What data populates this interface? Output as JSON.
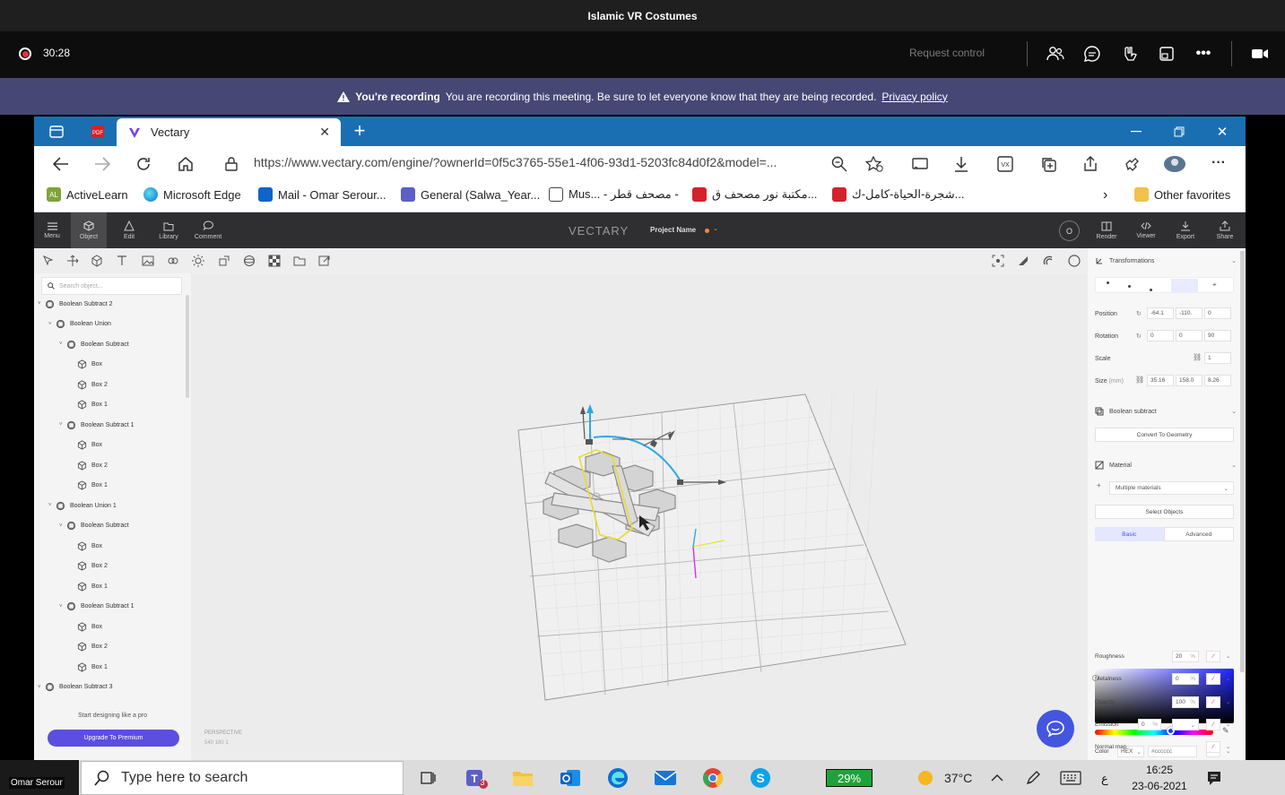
{
  "teams": {
    "meeting_title": "Islamic VR Costumes",
    "timer": "30:28",
    "request_control": "Request control",
    "banner": {
      "bold": "You're recording",
      "text": "You are recording this meeting. Be sure to let everyone know that they are being recorded.",
      "link": "Privacy policy"
    }
  },
  "browser": {
    "tab_title": "Vectary",
    "url": "https://www.vectary.com/engine/?ownerId=0f5c3765-55e1-4f06-93d1-5203fc84d0f2&model=...",
    "favorites": [
      {
        "label": "ActiveLearn"
      },
      {
        "label": "Microsoft Edge"
      },
      {
        "label": "Mail - Omar Serour..."
      },
      {
        "label": "General (Salwa_Year..."
      },
      {
        "label": "Mus... - مصحف قطر -"
      },
      {
        "label": "مكتبة نور مصحف ق..."
      },
      {
        "label": "شجرة-الحياة-كامل-ك..."
      }
    ],
    "other_favorites": "Other favorites"
  },
  "vectary": {
    "logo": "VECTARY",
    "project_name": "Project Name",
    "avatar_letter": "O",
    "left_buttons": [
      {
        "label": "Menu"
      },
      {
        "label": "Object"
      },
      {
        "label": "Edit"
      },
      {
        "label": "Library"
      },
      {
        "label": "Comment"
      }
    ],
    "right_buttons": [
      {
        "label": "Render"
      },
      {
        "label": "Viewer"
      },
      {
        "label": "Export"
      },
      {
        "label": "Share"
      }
    ],
    "search_placeholder": "Search object...",
    "tree": [
      {
        "label": "Boolean Subtract 2",
        "level": 0
      },
      {
        "label": "Boolean Union",
        "level": 1
      },
      {
        "label": "Boolean Subtract",
        "level": 2
      },
      {
        "label": "Box",
        "level": 3
      },
      {
        "label": "Box 2",
        "level": 3
      },
      {
        "label": "Box 1",
        "level": 3
      },
      {
        "label": "Boolean Subtract 1",
        "level": 2
      },
      {
        "label": "Box",
        "level": 3
      },
      {
        "label": "Box 2",
        "level": 3
      },
      {
        "label": "Box 1",
        "level": 3
      },
      {
        "label": "Boolean Union 1",
        "level": 1
      },
      {
        "label": "Boolean Subtract",
        "level": 2
      },
      {
        "label": "Box",
        "level": 3
      },
      {
        "label": "Box 2",
        "level": 3
      },
      {
        "label": "Box 1",
        "level": 3
      },
      {
        "label": "Boolean Subtract 1",
        "level": 2
      },
      {
        "label": "Box",
        "level": 3
      },
      {
        "label": "Box 2",
        "level": 3
      },
      {
        "label": "Box 1",
        "level": 3
      },
      {
        "label": "Boolean Subtract 3",
        "level": 0
      }
    ],
    "promo_text": "Start designing like a pro",
    "upgrade_label": "Upgrade To Premium",
    "viewport": {
      "camera": "PERSPECTIVE",
      "stats": "540   180   1"
    },
    "props": {
      "transformations": "Transformations",
      "position_label": "Position",
      "position": [
        "-64.1",
        "-110.",
        "0"
      ],
      "rotation_label": "Rotation",
      "rotation": [
        "0",
        "0",
        "90"
      ],
      "scale_label": "Scale",
      "scale": "1",
      "size_label": "Size",
      "size_unit": "(mm)",
      "size": [
        "35.16",
        "158.0",
        "8.26"
      ],
      "boolean_label": "Boolean subtract",
      "convert_label": "Convert To Geometry",
      "material_label": "Material",
      "multiple_materials": "Multiple materials",
      "select_objects": "Select Objects",
      "tab_basic": "Basic",
      "tab_advanced": "Advanced",
      "color_label": "Color",
      "color_mode": "HEX",
      "color_value": "#cccccc",
      "roughness_label": "Roughness",
      "roughness": "20",
      "metalness_label": "Metalness",
      "metalness": "0",
      "opacity_label": "Opacity",
      "opacity": "100",
      "emission_label": "Emission",
      "emission": "0",
      "normal_label": "Normal map",
      "percent": "%"
    }
  },
  "taskbar": {
    "user_label": "Omar Serour",
    "search_text": "Type here to search",
    "teams_badge": "3",
    "battery": "29%",
    "temperature": "37°C",
    "language": "ع",
    "time": "16:25",
    "date": "23-06-2021"
  },
  "colors": {
    "teams_banner": "#464775",
    "edge_tabbar": "#1a6fb3",
    "vectary_topbar": "#2f2f31",
    "upgrade": "#5b4ee0",
    "chat_fab": "#4455e0",
    "battery": "#1fa339"
  }
}
